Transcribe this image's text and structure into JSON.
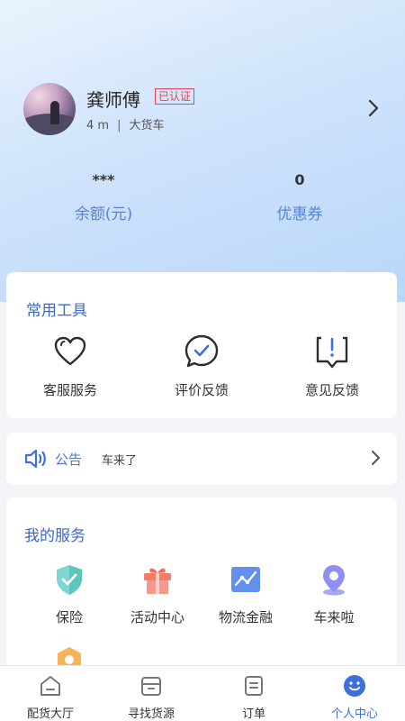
{
  "profile": {
    "name": "龚师傅",
    "verified_badge": "已认证",
    "truck_length": "4 m",
    "separator": "|",
    "truck_type": "大货车"
  },
  "stats": {
    "balance_value": "***",
    "balance_label": "余额(元)",
    "coupon_value": "0",
    "coupon_label": "优惠券"
  },
  "tools": {
    "title": "常用工具",
    "items": [
      {
        "label": "客服服务",
        "icon": "heart-icon"
      },
      {
        "label": "评价反馈",
        "icon": "chat-check-icon"
      },
      {
        "label": "意见反馈",
        "icon": "feedback-icon"
      }
    ]
  },
  "notice": {
    "tag": "公告",
    "message": "车来了",
    "icon": "speaker-icon"
  },
  "services": {
    "title": "我的服务",
    "items": [
      {
        "label": "保险",
        "icon": "shield-check-icon"
      },
      {
        "label": "活动中心",
        "icon": "gift-icon"
      },
      {
        "label": "物流金融",
        "icon": "chart-icon"
      },
      {
        "label": "车来啦",
        "icon": "location-pin-icon"
      }
    ]
  },
  "tabbar": {
    "items": [
      {
        "label": "配货大厅",
        "icon": "home-icon"
      },
      {
        "label": "寻找货源",
        "icon": "box-icon"
      },
      {
        "label": "订单",
        "icon": "order-list-icon"
      },
      {
        "label": "个人中心",
        "icon": "user-icon"
      }
    ],
    "active_index": 3
  },
  "colors": {
    "accent": "#3e6fdc",
    "label_blue": "#5a83d6",
    "verified_red": "#e64553",
    "hero_gradient_start": "#e9f3fd",
    "hero_gradient_end": "#b9d7fa"
  }
}
